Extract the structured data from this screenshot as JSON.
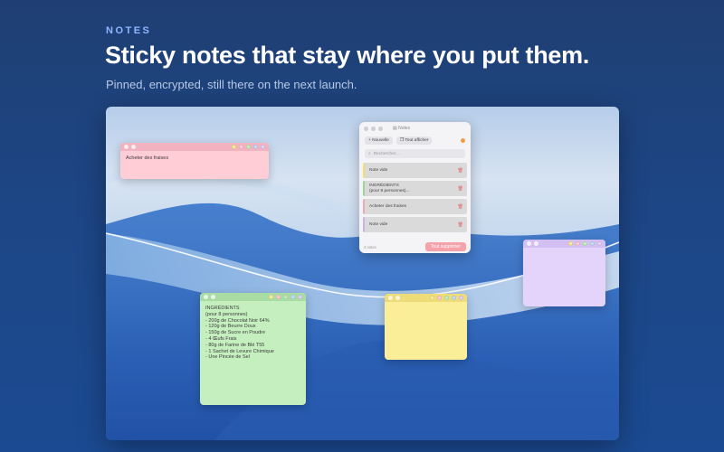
{
  "header": {
    "eyebrow": "NOTES",
    "headline": "Sticky notes that stay where you put them.",
    "subline": "Pinned, encrypted, still there on the next launch."
  },
  "colors": {
    "pink": "#ffcdd6",
    "green": "#c6efc0",
    "yellow": "#fbee99",
    "purple": "#e4d3fb",
    "accent_orange": "#f39a4b",
    "danger": "#f4a3ab"
  },
  "notes": {
    "pink": {
      "text": "Acheter des fraises"
    },
    "green": {
      "text": "INGRÉDIENTS\n(pour 8 personnes)\n- 200g de Chocolat Noir 64%\n- 120g de Beurre Doux\n- 150g de Sucre en Poudre\n- 4 Œufs Frais\n- 80g de Farine de Blé T55\n- 1 Sachet de Levure Chimique\n- Une Pincée de Sel"
    },
    "yellow": {
      "text": ""
    },
    "purple": {
      "text": ""
    }
  },
  "app": {
    "title": "Notes",
    "new_button": "Nouvelle",
    "show_all_button": "Tout afficher",
    "search_placeholder": "Rechercher...",
    "items": [
      {
        "label": "Note vide"
      },
      {
        "label": "INGRÉDIENTS\n(pour 8 personnes)..."
      },
      {
        "label": "Acheter des fraises"
      },
      {
        "label": "Note vide"
      }
    ],
    "count": "4 notes",
    "delete_all_button": "Tout supprimer"
  }
}
